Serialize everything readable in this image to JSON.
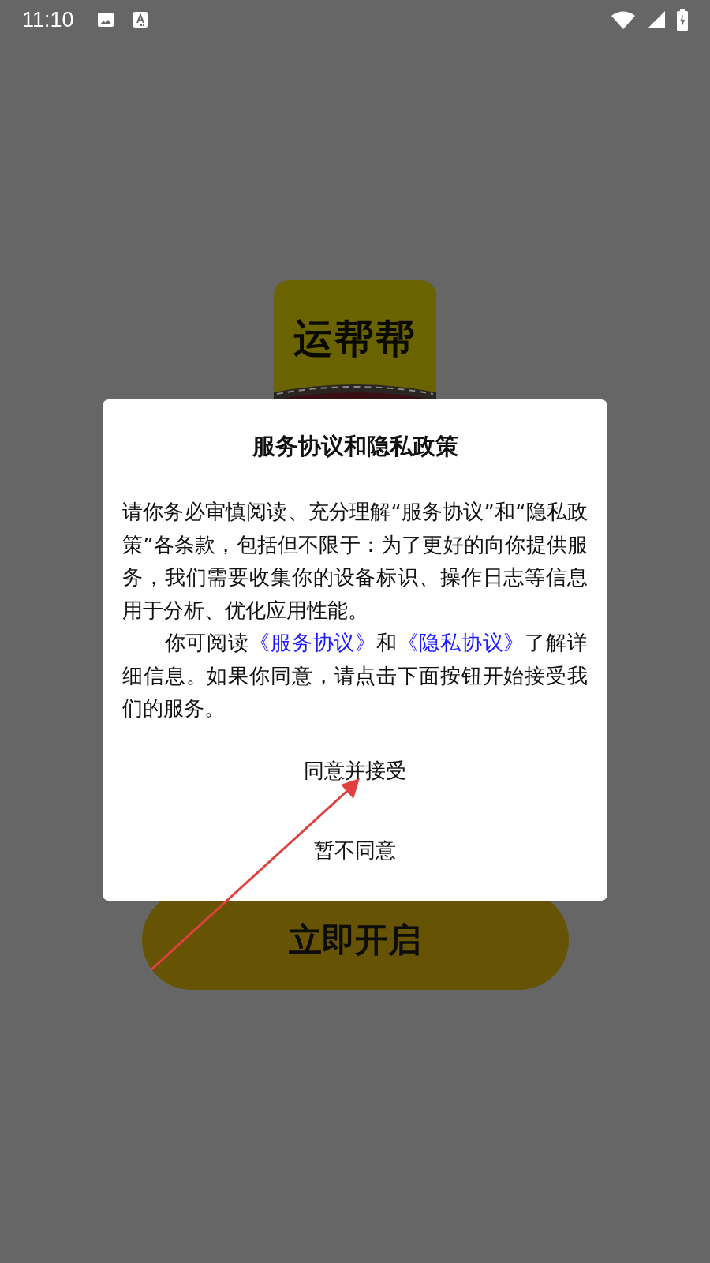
{
  "status_bar": {
    "time": "11:10"
  },
  "logo": {
    "text": "运帮帮"
  },
  "start_button": {
    "label": "立即开启"
  },
  "dialog": {
    "title": "服务协议和隐私政策",
    "paragraphs": [
      {
        "parts": [
          {
            "kind": "text",
            "text": "请你务必审慎阅读、充分理解“服务协议”和“隐私政策”各条款，包括但不限于：为了更好的向你提供服务，我们需要收集你的设备标识、操作日志等信息用于分析、优化应用性能。"
          }
        ]
      },
      {
        "parts": [
          {
            "kind": "text",
            "text": "你可阅读"
          },
          {
            "kind": "link",
            "text": "《服务协议》"
          },
          {
            "kind": "text",
            "text": "和"
          },
          {
            "kind": "link",
            "text": "《隐私协议》"
          },
          {
            "kind": "text",
            "text": "了解详细信息。如果你同意，请点击下面按钮开始接受我们的服务。"
          }
        ]
      }
    ],
    "buttons": [
      {
        "label": "同意并接受"
      },
      {
        "label": "暂不同意"
      }
    ]
  }
}
